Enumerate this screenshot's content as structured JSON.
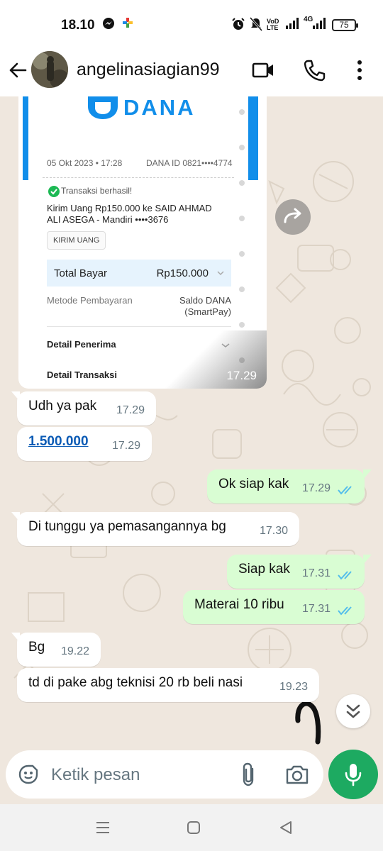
{
  "status": {
    "time": "18.10",
    "battery": "75",
    "net_label": "4G"
  },
  "header": {
    "contact_name": "angelinasiagian99"
  },
  "receipt": {
    "brand": "DANA",
    "date": "05 Okt 2023 • 17:28",
    "dana_id": "DANA ID 0821••••4774",
    "status": "Transaksi berhasil!",
    "desc_line1": "Kirim Uang Rp150.000 ke SAID AHMAD",
    "desc_line2": "ALI ASEGA - Mandiri ••••3676",
    "tag": "KIRIM UANG",
    "total_label": "Total Bayar",
    "total_value": "Rp150.000",
    "method_label": "Metode Pembayaran",
    "method_value": "Saldo DANA (SmartPay)",
    "detail_penerima": "Detail Penerima",
    "detail_transaksi": "Detail Transaksi",
    "time": "17.29"
  },
  "messages": [
    {
      "dir": "in",
      "text": "Udh ya pak",
      "time": "17.29"
    },
    {
      "dir": "in",
      "text": "1.500.000",
      "time": "17.29",
      "is_link": true
    },
    {
      "dir": "out",
      "text": "Ok siap kak",
      "time": "17.29",
      "read": true
    },
    {
      "dir": "in",
      "text": "Di tunggu ya pemasangannya bg",
      "time": "17.30"
    },
    {
      "dir": "out",
      "text": "Siap kak",
      "time": "17.31",
      "read": true
    },
    {
      "dir": "out",
      "text": "Materai 10 ribu",
      "time": "17.31",
      "read": true
    },
    {
      "dir": "in",
      "text": "Bg",
      "time": "19.22"
    },
    {
      "dir": "in",
      "text": "td di pake abg teknisi 20 rb beli nasi",
      "time": "19.23"
    }
  ],
  "composer": {
    "placeholder": "Ketik pesan"
  },
  "colors": {
    "accent": "#1daa61",
    "outgoing_bubble": "#d9fdd3",
    "chat_bg": "#efe7de",
    "read_ticks": "#53bdeb",
    "dana_blue": "#118eea"
  }
}
